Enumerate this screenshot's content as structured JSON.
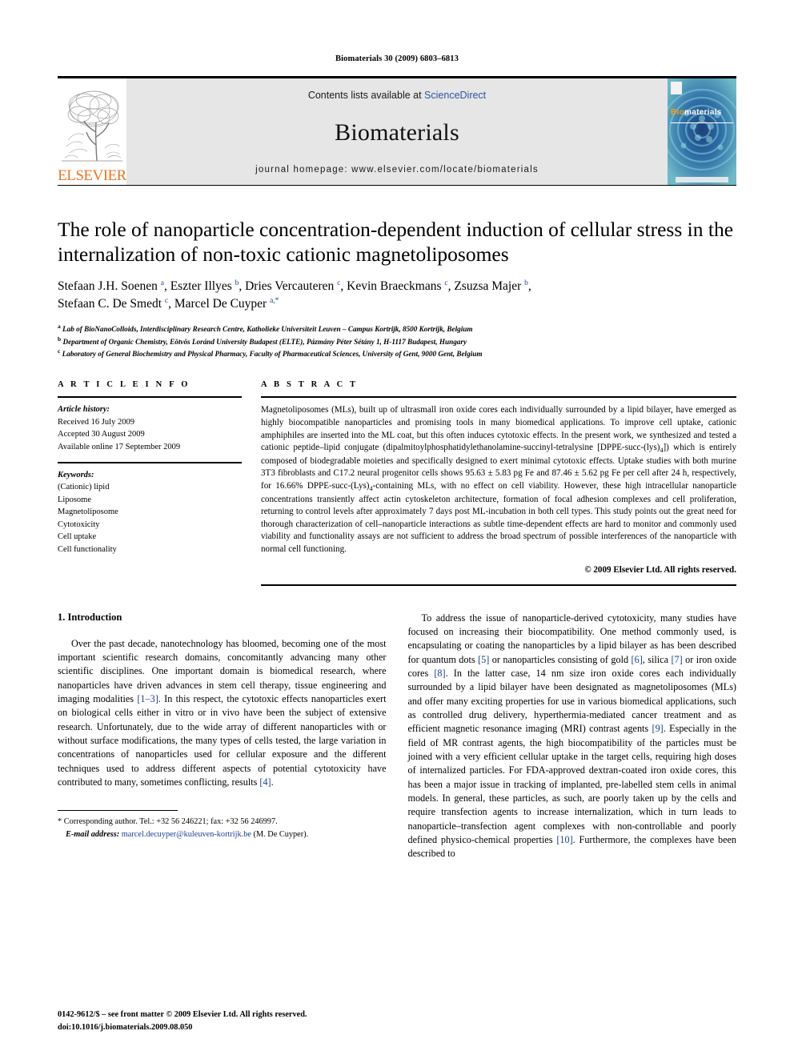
{
  "running_head": "Biomaterials 30 (2009) 6803–6813",
  "masthead": {
    "publisher_name": "ELSEVIER",
    "contents_prefix": "Contents lists available at ",
    "contents_link": "ScienceDirect",
    "journal_name": "Biomaterials",
    "homepage": "journal homepage: www.elsevier.com/locate/biomaterials",
    "cover_title_first": "Bio",
    "cover_title_rest": "materials",
    "link_color": "#2b55a3",
    "elsevier_orange": "#E87722"
  },
  "article": {
    "title": "The role of nanoparticle concentration-dependent induction of cellular stress in the internalization of non-toxic cationic magnetoliposomes",
    "authors": "Stefaan J.H. Soenen a, Eszter Illyes b, Dries Vercauteren c, Kevin Braeckmans c, Zsuzsa Majer b, Stefaan C. De Smedt c, Marcel De Cuyper a,*",
    "affiliations": [
      "Lab of BioNanoColloids, Interdisciplinary Research Centre, Katholieke Universiteit Leuven – Campus Kortrijk, 8500 Kortrijk, Belgium",
      "Department of Organic Chemistry, Eötvös Loránd University Budapest (ELTE), Pázmány Péter Sétány 1, H-1117 Budapest, Hungary",
      "Laboratory of General Biochemistry and Physical Pharmacy, Faculty of Pharmaceutical Sciences, University of Gent, 9000 Gent, Belgium"
    ],
    "affiliation_marks": [
      "a",
      "b",
      "c"
    ]
  },
  "article_info": {
    "heading": "A R T I C L E  I N F O",
    "history_label": "Article history:",
    "history": [
      "Received 16 July 2009",
      "Accepted 30 August 2009",
      "Available online 17 September 2009"
    ],
    "keywords_label": "Keywords:",
    "keywords": [
      "(Cationic) lipid",
      "Liposome",
      "Magnetoliposome",
      "Cytotoxicity",
      "Cell uptake",
      "Cell functionality"
    ]
  },
  "abstract": {
    "heading": "A B S T R A C T",
    "text": "Magnetoliposomes (MLs), built up of ultrasmall iron oxide cores each individually surrounded by a lipid bilayer, have emerged as highly biocompatible nanoparticles and promising tools in many biomedical applications. To improve cell uptake, cationic amphiphiles are inserted into the ML coat, but this often induces cytotoxic effects. In the present work, we synthesized and tested a cationic peptide–lipid conjugate (dipalmitoylphosphatidylethanolamine-succinyl-tetralysine [DPPE-succ-(lys)4]) which is entirely composed of biodegradable moieties and specifically designed to exert minimal cytotoxic effects. Uptake studies with both murine 3T3 fibroblasts and C17.2 neural progenitor cells shows 95.63 ± 5.83 pg Fe and 87.46 ± 5.62 pg Fe per cell after 24 h, respectively, for 16.66% DPPE-succ-(Lys)4-containing MLs, with no effect on cell viability. However, these high intracellular nanoparticle concentrations transiently affect actin cytoskeleton architecture, formation of focal adhesion complexes and cell proliferation, returning to control levels after approximately 7 days post ML-incubation in both cell types. This study points out the great need for thorough characterization of cell–nanoparticle interactions as subtle time-dependent effects are hard to monitor and commonly used viability and functionality assays are not sufficient to address the broad spectrum of possible interferences of the nanoparticle with normal cell functioning.",
    "copyright": "© 2009 Elsevier Ltd. All rights reserved."
  },
  "introduction": {
    "heading": "1.  Introduction",
    "left_paragraph": "Over the past decade, nanotechnology has bloomed, becoming one of the most important scientific research domains, concomitantly advancing many other scientific disciplines. One important domain is biomedical research, where nanoparticles have driven advances in stem cell therapy, tissue engineering and imaging modalities [1–3]. In this respect, the cytotoxic effects nanoparticles exert on biological cells either in vitro or in vivo have been the subject of extensive research. Unfortunately, due to the wide array of different nanoparticles with or without surface modifications, the many types of cells tested, the large variation in concentrations of nanoparticles used for cellular exposure and the different techniques used to address different aspects of potential cytotoxicity have contributed to many, sometimes conflicting, results [4].",
    "right_paragraph": "To address the issue of nanoparticle-derived cytotoxicity, many studies have focused on increasing their biocompatibility. One method commonly used, is encapsulating or coating the nanoparticles by a lipid bilayer as has been described for quantum dots [5] or nanoparticles consisting of gold [6], silica [7] or iron oxide cores [8]. In the latter case, 14 nm size iron oxide cores each individually surrounded by a lipid bilayer have been designated as magnetoliposomes (MLs) and offer many exciting properties for use in various biomedical applications, such as controlled drug delivery, hyperthermia-mediated cancer treatment and as efficient magnetic resonance imaging (MRI) contrast agents [9]. Especially in the field of MR contrast agents, the high biocompatibility of the particles must be joined with a very efficient cellular uptake in the target cells, requiring high doses of internalized particles. For FDA-approved dextran-coated iron oxide cores, this has been a major issue in tracking of implanted, pre-labelled stem cells in animal models. In general, these particles, as such, are poorly taken up by the cells and require transfection agents to increase internalization, which in turn leads to nanoparticle–transfection agent complexes with non-controllable and poorly defined physico-chemical properties [10]. Furthermore, the complexes have been described to"
  },
  "footnotes": {
    "corresponding": "* Corresponding author. Tel.: +32 56 246221; fax: +32 56 246997.",
    "email_label": "E-mail address:",
    "email": "marcel.decuyper@kuleuven-kortrijk.be",
    "email_suffix": "(M. De Cuyper)."
  },
  "footer": {
    "issn_line": "0142-9612/$ – see front matter © 2009 Elsevier Ltd. All rights reserved.",
    "doi_line": "doi:10.1016/j.biomaterials.2009.08.050"
  }
}
